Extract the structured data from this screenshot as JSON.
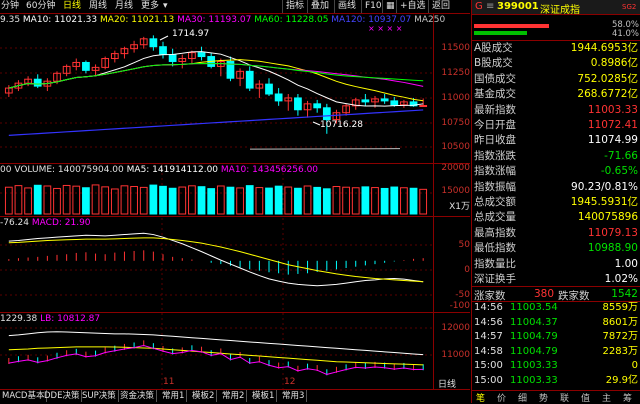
{
  "toolbar": {
    "periods": [
      "分钟",
      "60分钟",
      "日线",
      "周线",
      "月线",
      "更多"
    ],
    "selected_period": "日线",
    "right_buttons": [
      "指标",
      "叠加",
      "画线",
      "F10",
      "+自选",
      "返回"
    ]
  },
  "ma_line": {
    "prefix": "9.35",
    "ma10": "MA10: 11021.33",
    "ma20": "MA20: 11021.13",
    "ma30": "MA30: 11193.07",
    "ma60": "MA60: 11228.05",
    "ma120": "MA120: 10937.07",
    "ma250": "MA250"
  },
  "annotations": {
    "high": "1714.97",
    "low": "10716.28"
  },
  "volume_line": {
    "label": "VOLUME: 140075904.00",
    "ma5": "MA5: 141914112.00",
    "ma10": "MA10: 143456256.00",
    "unit": "X1万"
  },
  "macd_line": {
    "value": "-76.24",
    "macd": "MACD: 21.90"
  },
  "lb_line": {
    "value": "1229.38",
    "lb": "LB: 10812.87"
  },
  "x_labels": [
    "11",
    "12"
  ],
  "bottom_tabs": [
    "MACD基本",
    "DDE决策",
    "SUP决策",
    "资金决策",
    "常用1",
    "模板2",
    "常用2",
    "模板1",
    "常用3"
  ],
  "chart_data": [
    {
      "type": "candlestick",
      "title": "",
      "y_ticks": [
        "11500",
        "11250",
        "11000",
        "10750",
        "10500"
      ],
      "ylim": [
        10450,
        11800
      ],
      "high_annotation": 11714.97,
      "low_annotation": 10716.28,
      "series": [
        {
          "name": "MA10",
          "color": "#ffffff"
        },
        {
          "name": "MA20",
          "color": "#ffff00"
        },
        {
          "name": "MA30",
          "color": "#ff00ff"
        },
        {
          "name": "MA60",
          "color": "#00ff00"
        },
        {
          "name": "MA120",
          "color": "#3333ff"
        },
        {
          "name": "MA250",
          "color": "#c0c0c0"
        }
      ],
      "ohlc": [
        [
          11130,
          11210,
          11090,
          11180
        ],
        [
          11180,
          11260,
          11150,
          11230
        ],
        [
          11230,
          11300,
          11200,
          11270
        ],
        [
          11270,
          11320,
          11180,
          11200
        ],
        [
          11200,
          11280,
          11150,
          11250
        ],
        [
          11250,
          11350,
          11220,
          11330
        ],
        [
          11330,
          11420,
          11300,
          11400
        ],
        [
          11400,
          11480,
          11360,
          11440
        ],
        [
          11440,
          11460,
          11330,
          11360
        ],
        [
          11360,
          11420,
          11300,
          11390
        ],
        [
          11390,
          11500,
          11370,
          11480
        ],
        [
          11480,
          11560,
          11440,
          11530
        ],
        [
          11530,
          11600,
          11480,
          11580
        ],
        [
          11580,
          11660,
          11540,
          11620
        ],
        [
          11620,
          11700,
          11580,
          11680
        ],
        [
          11680,
          11715,
          11560,
          11600
        ],
        [
          11600,
          11650,
          11480,
          11520
        ],
        [
          11520,
          11580,
          11400,
          11450
        ],
        [
          11450,
          11520,
          11380,
          11480
        ],
        [
          11480,
          11560,
          11430,
          11540
        ],
        [
          11540,
          11600,
          11460,
          11500
        ],
        [
          11500,
          11540,
          11380,
          11400
        ],
        [
          11400,
          11480,
          11300,
          11450
        ],
        [
          11450,
          11500,
          11250,
          11280
        ],
        [
          11280,
          11380,
          11200,
          11350
        ],
        [
          11350,
          11400,
          11150,
          11180
        ],
        [
          11180,
          11260,
          11080,
          11220
        ],
        [
          11220,
          11280,
          11100,
          11120
        ],
        [
          11120,
          11180,
          11000,
          11050
        ],
        [
          11050,
          11120,
          10950,
          11080
        ],
        [
          11080,
          11120,
          10900,
          10960
        ],
        [
          10960,
          11050,
          10880,
          11020
        ],
        [
          11020,
          11060,
          10930,
          10980
        ],
        [
          10980,
          11020,
          10716,
          10860
        ],
        [
          10860,
          10960,
          10820,
          10930
        ],
        [
          10930,
          11020,
          10900,
          11000
        ],
        [
          11000,
          11080,
          10960,
          11060
        ],
        [
          11060,
          11120,
          11000,
          11040
        ],
        [
          11040,
          11100,
          10980,
          11070
        ],
        [
          11070,
          11120,
          11020,
          11050
        ],
        [
          11050,
          11090,
          10990,
          11010
        ],
        [
          11010,
          11060,
          10980,
          11040
        ],
        [
          11040,
          11080,
          10990,
          11000
        ],
        [
          11000,
          11075,
          10990,
          11003
        ]
      ]
    },
    {
      "type": "bar",
      "title": "",
      "y_ticks": [
        "20000",
        "15000",
        "10000",
        "5000"
      ],
      "ylim": [
        0,
        21000
      ],
      "values": [
        15200,
        16100,
        14800,
        16300,
        15900,
        14500,
        16200,
        15800,
        14900,
        16500,
        15400,
        14200,
        16000,
        15600,
        15100,
        16400,
        15700,
        14600,
        15300,
        16000,
        15500,
        14400,
        15900,
        15200,
        14800,
        16100,
        15000,
        14700,
        15800,
        15300,
        14600,
        15900,
        15100,
        14300,
        15600,
        15200,
        14900,
        15400,
        15000,
        14500,
        15300,
        14900,
        14600,
        14000
      ],
      "up_flags": [
        1,
        1,
        1,
        0,
        1,
        1,
        1,
        1,
        0,
        1,
        1,
        1,
        1,
        1,
        1,
        0,
        0,
        0,
        1,
        1,
        0,
        0,
        1,
        0,
        1,
        0,
        1,
        0,
        0,
        1,
        0,
        1,
        0,
        0,
        1,
        1,
        1,
        0,
        1,
        0,
        0,
        1,
        0,
        1
      ]
    },
    {
      "type": "line",
      "title": "MACD",
      "y_ticks": [
        "50",
        "0",
        "-50",
        "-100"
      ],
      "ylim": [
        -150,
        100
      ],
      "histogram": [
        5,
        8,
        10,
        12,
        15,
        18,
        20,
        24,
        26,
        22,
        20,
        25,
        28,
        30,
        32,
        28,
        20,
        12,
        8,
        4,
        0,
        -6,
        -10,
        -15,
        -20,
        -26,
        -30,
        -35,
        -38,
        -42,
        -40,
        -38,
        -34,
        -30,
        -26,
        -22,
        -18,
        -14,
        -10,
        -6,
        -2,
        2,
        6,
        8
      ],
      "dif": [
        60,
        62,
        65,
        68,
        70,
        72,
        74,
        76,
        78,
        77,
        76,
        78,
        80,
        82,
        84,
        80,
        72,
        62,
        52,
        40,
        28,
        15,
        2,
        -10,
        -22,
        -34,
        -45,
        -55,
        -62,
        -68,
        -72,
        -74,
        -76,
        -74,
        -72,
        -68,
        -64,
        -60,
        -58,
        -55,
        -54,
        -56,
        -60,
        -64
      ],
      "dea": [
        55,
        56,
        58,
        60,
        62,
        63,
        64,
        65,
        66,
        66,
        66,
        67,
        68,
        69,
        70,
        70,
        68,
        65,
        62,
        58,
        54,
        48,
        42,
        35,
        28,
        20,
        12,
        4,
        -4,
        -12,
        -18,
        -24,
        -30,
        -35,
        -40,
        -44,
        -48,
        -51,
        -54,
        -56,
        -58,
        -60,
        -62,
        -64
      ]
    },
    {
      "type": "line",
      "title": "LB",
      "y_ticks": [
        "12000",
        "11000"
      ],
      "ylim": [
        10500,
        12200
      ],
      "bars": [
        11180,
        11230,
        11270,
        11200,
        11250,
        11330,
        11400,
        11440,
        11360,
        11390,
        11480,
        11530,
        11580,
        11620,
        11680,
        11600,
        11520,
        11450,
        11480,
        11540,
        11500,
        11400,
        11450,
        11280,
        11350,
        11180,
        11220,
        11120,
        11050,
        11080,
        10960,
        11020,
        10980,
        10860,
        10930,
        11000,
        11060,
        11040,
        11070,
        11050,
        11010,
        11040,
        11000,
        11003
      ],
      "line1": [
        11900,
        11920,
        11950,
        11980,
        12000,
        12010,
        12000,
        11990,
        11980,
        11970,
        11960,
        11950,
        11950,
        11940,
        11930,
        11920,
        11900,
        11880,
        11860,
        11840,
        11820,
        11800,
        11780,
        11760,
        11740,
        11720,
        11700,
        11680,
        11660,
        11640,
        11620,
        11600,
        11580,
        11560,
        11540,
        11520,
        11500,
        11480,
        11460,
        11440,
        11420,
        11400,
        11380,
        11360
      ],
      "line2": [
        11500,
        11510,
        11520,
        11540,
        11550,
        11560,
        11570,
        11580,
        11580,
        11580,
        11580,
        11575,
        11570,
        11560,
        11550,
        11540,
        11520,
        11500,
        11480,
        11460,
        11440,
        11420,
        11400,
        11380,
        11360,
        11340,
        11320,
        11300,
        11280,
        11260,
        11240,
        11220,
        11200,
        11180,
        11160,
        11150,
        11140,
        11130,
        11120,
        11110,
        11100,
        11090,
        11080,
        11070
      ]
    }
  ],
  "quote": {
    "code": "399001",
    "name": "深证成指",
    "tag": "SG2",
    "bar_top_pct": "58.0%",
    "bar_bottom_pct": "41.0%",
    "bar_top_value": 58.0,
    "bar_bottom_value": 41.0,
    "rows": [
      {
        "label": "A股成交",
        "value": "1944.6953亿",
        "color": "#ffff00"
      },
      {
        "label": "B股成交",
        "value": "0.8986亿",
        "color": "#ffff00"
      },
      {
        "label": "国债成交",
        "value": "752.0285亿",
        "color": "#ffff00"
      },
      {
        "label": "基金成交",
        "value": "268.6772亿",
        "color": "#ffff00"
      },
      {
        "label": "最新指数",
        "value": "11003.33",
        "color": "#ff3333"
      },
      {
        "label": "今日开盘",
        "value": "11072.41",
        "color": "#ff3333"
      },
      {
        "label": "昨日收盘",
        "value": "11074.99",
        "color": "#ffffff"
      },
      {
        "label": "指数涨跌",
        "value": "-71.66",
        "color": "#00e000"
      },
      {
        "label": "指数涨幅",
        "value": "-0.65%",
        "color": "#00e000"
      },
      {
        "label": "指数振幅",
        "value": "90.23/0.81%",
        "color": "#ffffff"
      },
      {
        "label": "总成交额",
        "value": "1945.5931亿",
        "color": "#ffff00"
      },
      {
        "label": "总成交量",
        "value": "140075896",
        "color": "#ffff00"
      },
      {
        "label": "最高指数",
        "value": "11079.13",
        "color": "#ff3333"
      },
      {
        "label": "最低指数",
        "value": "10988.90",
        "color": "#00e000"
      },
      {
        "label": "指数量比",
        "value": "1.00",
        "color": "#ffffff"
      },
      {
        "label": "深证换手",
        "value": "1.02%",
        "color": "#ffffff"
      }
    ],
    "rise_label": "涨家数",
    "rise_value": "380",
    "fall_label": "跌家数",
    "fall_value": "1542",
    "ticks": [
      {
        "time": "14:56",
        "price": "11003.54",
        "vol": "8559万"
      },
      {
        "time": "14:56",
        "price": "11004.37",
        "vol": "8601万"
      },
      {
        "time": "14:57",
        "price": "11004.79",
        "vol": "7872万"
      },
      {
        "time": "14:58",
        "price": "11004.79",
        "vol": "2283万"
      },
      {
        "time": "15:00",
        "price": "11003.33",
        "vol": "0"
      },
      {
        "time": "15:00",
        "price": "11003.33",
        "vol": "29.9亿"
      }
    ],
    "bottom_icons": [
      "笔",
      "价",
      "细",
      "势",
      "联",
      "值",
      "主",
      "筹"
    ]
  }
}
